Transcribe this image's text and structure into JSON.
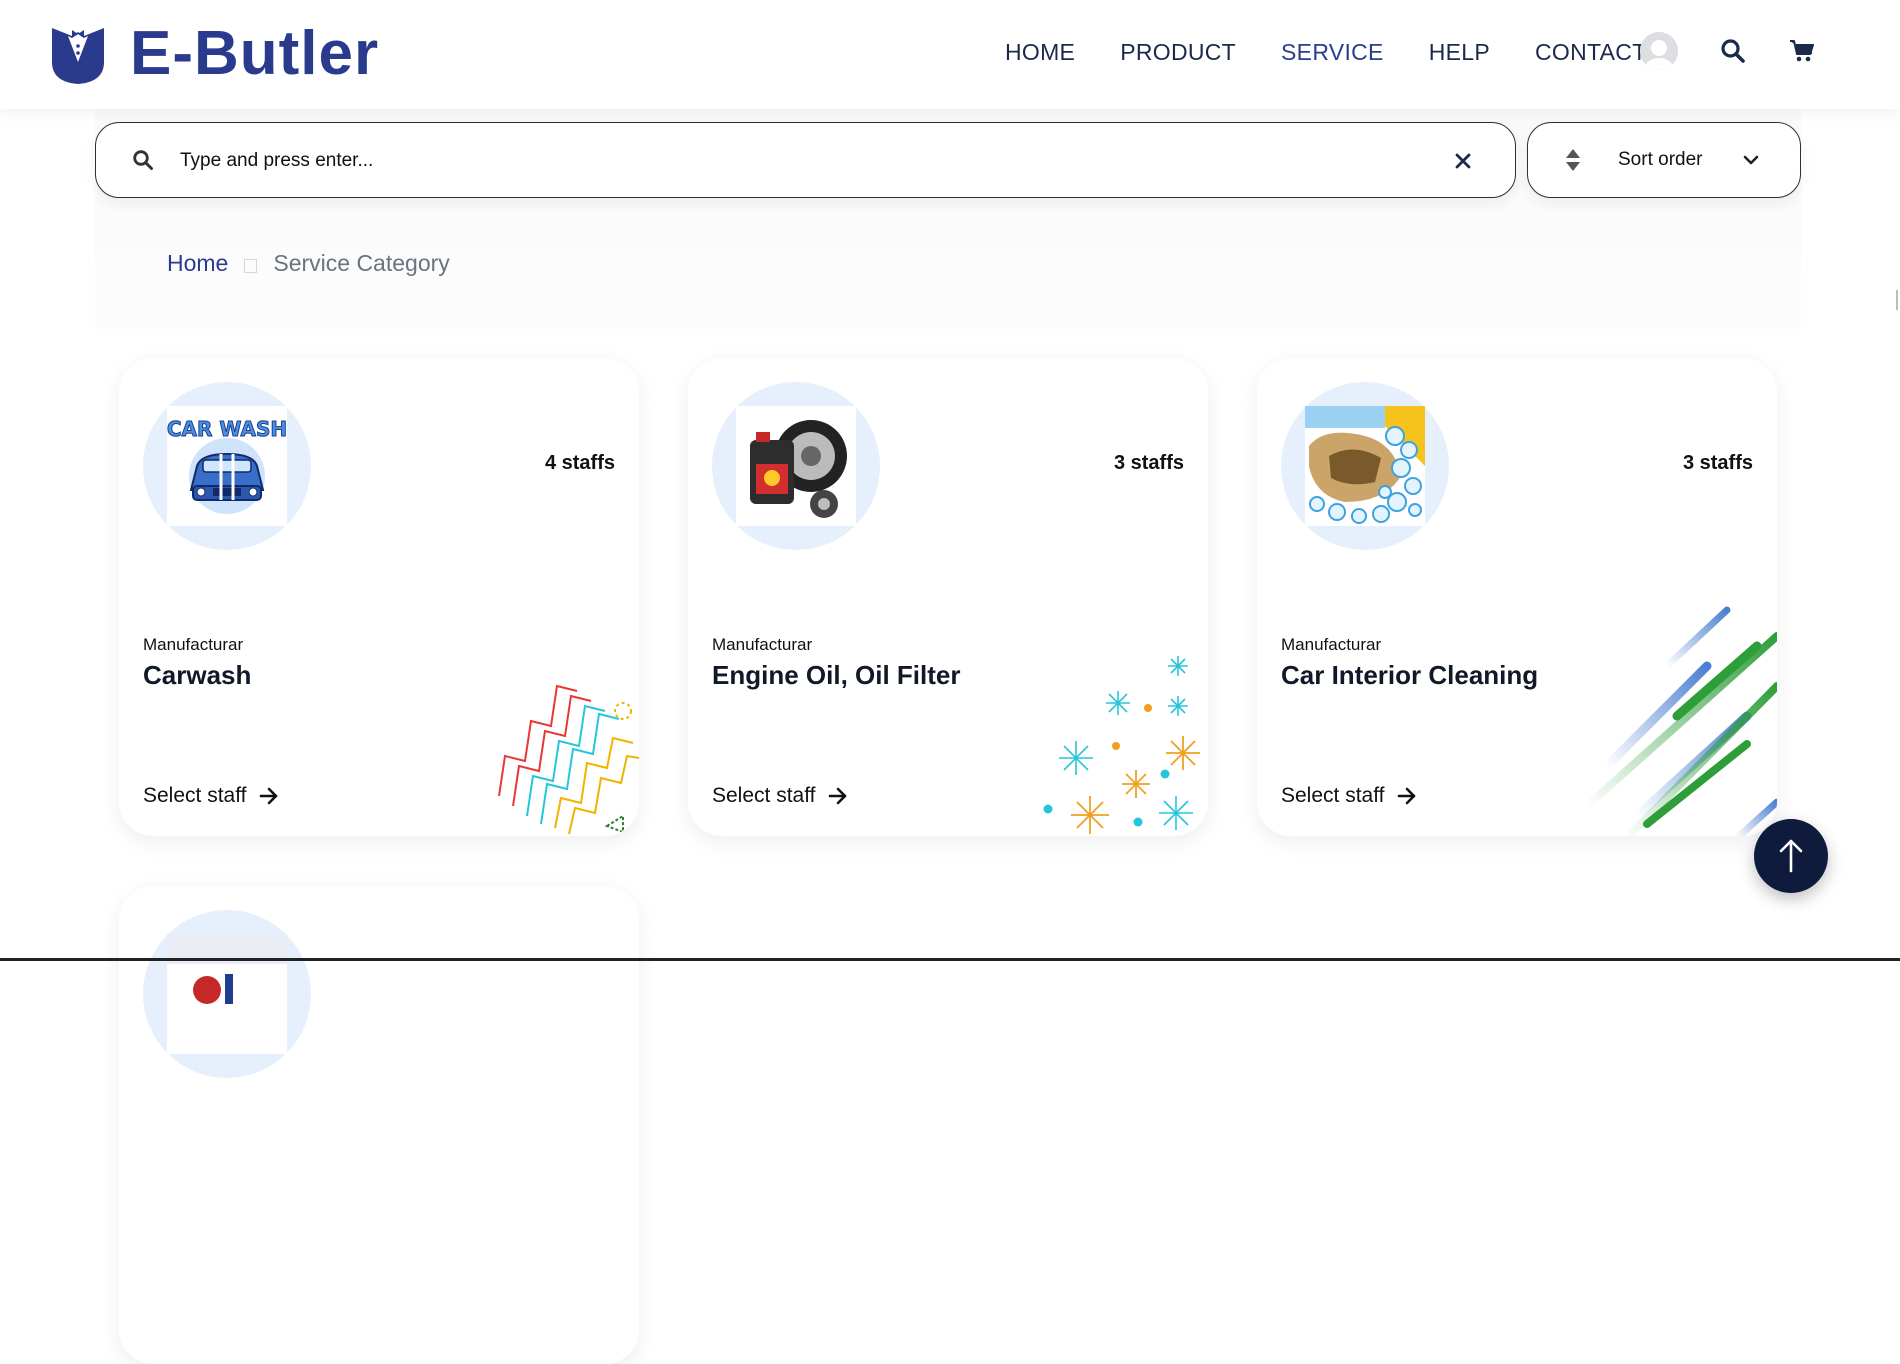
{
  "brand": {
    "name": "E-Butler",
    "color": "#2a3a8c"
  },
  "nav": {
    "items": [
      {
        "label": "HOME",
        "active": false
      },
      {
        "label": "PRODUCT",
        "active": false
      },
      {
        "label": "SERVICE",
        "active": true
      },
      {
        "label": "HELP",
        "active": false
      },
      {
        "label": "CONTACT",
        "active": false
      }
    ],
    "icons": [
      "user-avatar",
      "search-icon",
      "cart-icon"
    ]
  },
  "search": {
    "placeholder": "Type and press enter...",
    "value": ""
  },
  "sort": {
    "label": "Sort order"
  },
  "breadcrumb": {
    "home": "Home",
    "current": "Service Category"
  },
  "cards": [
    {
      "staffs": "4 staffs",
      "maker": "Manufacturar",
      "title": "Carwash",
      "action": "Select staff",
      "image": "car-wash-image"
    },
    {
      "staffs": "3 staffs",
      "maker": "Manufacturar",
      "title": "Engine Oil, Oil Filter",
      "action": "Select staff",
      "image": "engine-oil-image"
    },
    {
      "staffs": "3 staffs",
      "maker": "Manufacturar",
      "title": "Car Interior Cleaning",
      "action": "Select staff",
      "image": "interior-cleaning-image"
    }
  ],
  "colors": {
    "accent": "#2b3d8f",
    "dark": "#0f1b3d",
    "thumb_bg": "#e6effc"
  }
}
